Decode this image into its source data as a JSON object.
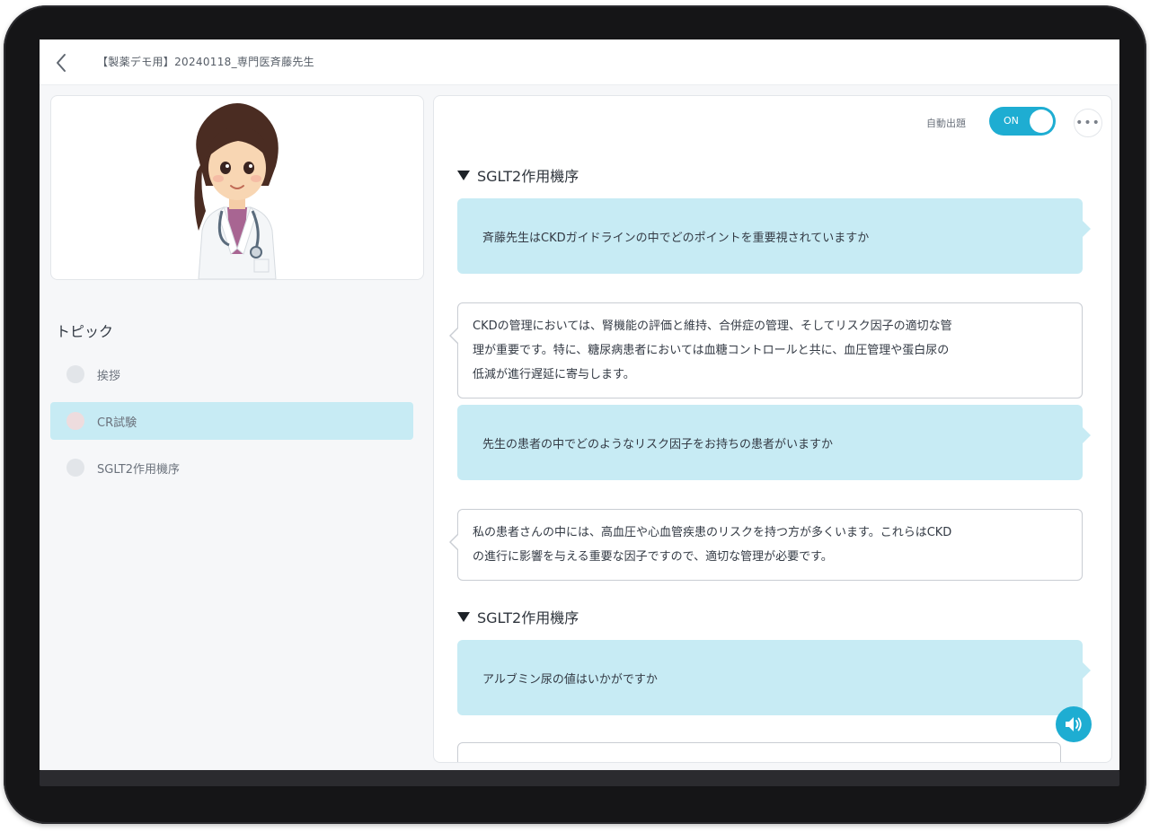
{
  "header": {
    "title": "【製薬デモ用】20240118_専門医斉藤先生"
  },
  "doctor": {
    "avatar_icon": "doctor-avatar-icon"
  },
  "topics": {
    "heading": "トピック",
    "items": [
      {
        "label": "挨拶",
        "active": false
      },
      {
        "label": "CR試験",
        "active": true
      },
      {
        "label": "SGLT2作用機序",
        "active": false
      }
    ]
  },
  "chat": {
    "autoplay_label": "自動出題",
    "toggle_label": "ON",
    "more_label": "•••",
    "sections": [
      {
        "heading": "SGLT2作用機序",
        "messages": [
          {
            "role": "question",
            "text": "斉藤先生はCKDガイドラインの中でどのポイントを重要視されていますか"
          },
          {
            "role": "answer",
            "lines": [
              "CKDの管理においては、腎機能の評価と維持、合併症の管理、そしてリスク因子の適切な管",
              "理が重要です。特に、糖尿病患者においては血糖コントロールと共に、血圧管理や蛋白尿の",
              "低減が進行遅延に寄与します。"
            ]
          },
          {
            "role": "question",
            "text": "先生の患者の中でどのようなリスク因子をお持ちの患者がいますか"
          },
          {
            "role": "answer",
            "lines": [
              "私の患者さんの中には、高血圧や心血管疾患のリスクを持つ方が多くいます。これらはCKD",
              "の進行に影響を与える重要な因子ですので、適切な管理が必要です。"
            ]
          }
        ]
      },
      {
        "heading": "SGLT2作用機序",
        "messages": [
          {
            "role": "question",
            "text": "アルブミン尿の値はいかがですか"
          }
        ]
      }
    ]
  },
  "colors": {
    "accent": "#1eadd2",
    "question_bubble": "#c7ebf4",
    "active_topic": "#c7ebf4"
  }
}
